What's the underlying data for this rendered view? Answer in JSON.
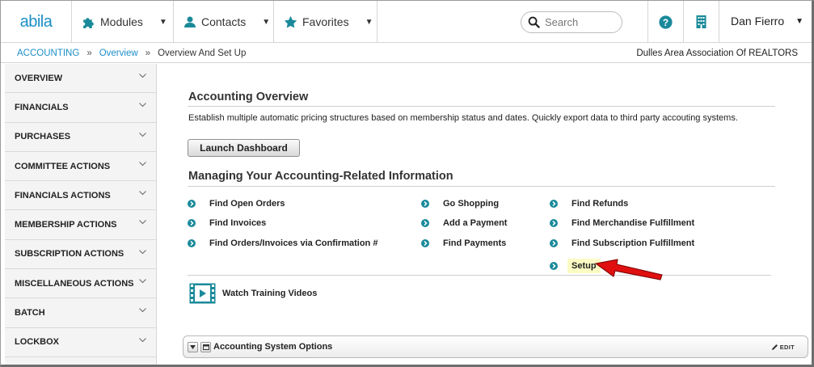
{
  "topbar": {
    "logo": "abila",
    "nav": [
      {
        "label": "Modules",
        "icon": "puzzle-icon"
      },
      {
        "label": "Contacts",
        "icon": "person-icon"
      },
      {
        "label": "Favorites",
        "icon": "star-icon"
      }
    ],
    "search_placeholder": "Search",
    "user_name": "Dan Fierro"
  },
  "breadcrumb": {
    "items": [
      "ACCOUNTING",
      "Overview",
      "Overview And Set Up"
    ],
    "organization": "Dulles Area Association Of REALTORS"
  },
  "sidebar": {
    "items": [
      "OVERVIEW",
      "FINANCIALS",
      "PURCHASES",
      "COMMITTEE ACTIONS",
      "FINANCIALS ACTIONS",
      "MEMBERSHIP ACTIONS",
      "SUBSCRIPTION ACTIONS",
      "MISCELLANEOUS ACTIONS",
      "BATCH",
      "LOCKBOX"
    ]
  },
  "main": {
    "overview_title": "Accounting Overview",
    "overview_desc": "Establish multiple automatic pricing structures based on membership status and dates. Quickly export data to third party accouting systems.",
    "launch_button": "Launch Dashboard",
    "managing_title": "Managing Your Accounting-Related Information",
    "links": {
      "col1": [
        "Find Open Orders",
        "Find Invoices",
        "Find Orders/Invoices via Confirmation #"
      ],
      "col2": [
        "Go Shopping",
        "Add a Payment",
        "Find Payments"
      ],
      "col3": [
        "Find Refunds",
        "Find Merchandise Fulfillment",
        "Find Subscription Fulfillment",
        "Setup"
      ]
    },
    "training_label": "Watch Training Videos",
    "options_title": "Accounting System Options",
    "edit_label": "EDIT"
  },
  "colors": {
    "brand_blue": "#1b8ec7",
    "bullet_teal": "#1a8a9a",
    "highlight": "#fbfbc4",
    "arrow_red": "#e01010"
  }
}
